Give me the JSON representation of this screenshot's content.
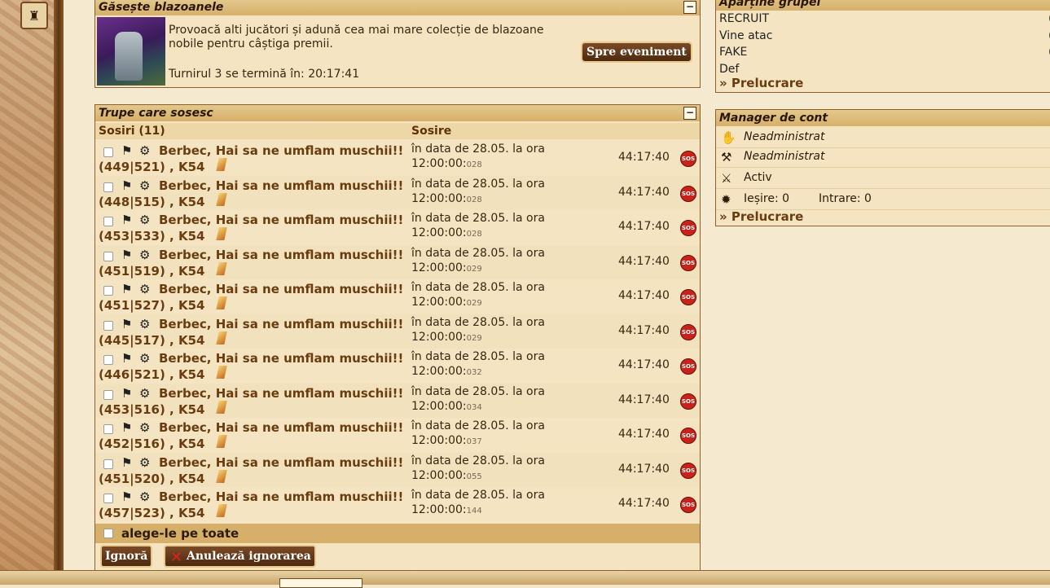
{
  "event_panel": {
    "title": "Găsește blazoanele",
    "description": "Provoacă alti jucători și adună cea mai mare colecție de blazoane nobile pentru câștiga premii.",
    "timer": "Turnirul 3 se termină în: 20:17:41",
    "button": "Spre eveniment"
  },
  "troops_panel": {
    "title": "Trupe care sosesc",
    "col_arrivals": "Sosiri (11)",
    "col_arrival": "Sosire",
    "rows": [
      {
        "name": "Berbec, Hai sa ne umflam muschii!!",
        "coords": "(449|521) , K54",
        "arrival": "în data de 28.05. la ora",
        "time": "12:00:00:",
        "ms": "028",
        "countdown": "44:17:40"
      },
      {
        "name": "Berbec, Hai sa ne umflam muschii!!",
        "coords": "(448|515) , K54",
        "arrival": "în data de 28.05. la ora",
        "time": "12:00:00:",
        "ms": "028",
        "countdown": "44:17:40"
      },
      {
        "name": "Berbec, Hai sa ne umflam muschii!!",
        "coords": "(453|533) , K54",
        "arrival": "în data de 28.05. la ora",
        "time": "12:00:00:",
        "ms": "028",
        "countdown": "44:17:40"
      },
      {
        "name": "Berbec, Hai sa ne umflam muschii!!",
        "coords": "(451|519) , K54",
        "arrival": "în data de 28.05. la ora",
        "time": "12:00:00:",
        "ms": "029",
        "countdown": "44:17:40"
      },
      {
        "name": "Berbec, Hai sa ne umflam muschii!!",
        "coords": "(451|527) , K54",
        "arrival": "în data de 28.05. la ora",
        "time": "12:00:00:",
        "ms": "029",
        "countdown": "44:17:40"
      },
      {
        "name": "Berbec, Hai sa ne umflam muschii!!",
        "coords": "(445|517) , K54",
        "arrival": "în data de 28.05. la ora",
        "time": "12:00:00:",
        "ms": "029",
        "countdown": "44:17:40"
      },
      {
        "name": "Berbec, Hai sa ne umflam muschii!!",
        "coords": "(446|521) , K54",
        "arrival": "în data de 28.05. la ora",
        "time": "12:00:00:",
        "ms": "032",
        "countdown": "44:17:40"
      },
      {
        "name": "Berbec, Hai sa ne umflam muschii!!",
        "coords": "(453|516) , K54",
        "arrival": "în data de 28.05. la ora",
        "time": "12:00:00:",
        "ms": "034",
        "countdown": "44:17:40"
      },
      {
        "name": "Berbec, Hai sa ne umflam muschii!!",
        "coords": "(452|516) , K54",
        "arrival": "în data de 28.05. la ora",
        "time": "12:00:00:",
        "ms": "037",
        "countdown": "44:17:40"
      },
      {
        "name": "Berbec, Hai sa ne umflam muschii!!",
        "coords": "(451|520) , K54",
        "arrival": "în data de 28.05. la ora",
        "time": "12:00:00:",
        "ms": "055",
        "countdown": "44:17:40"
      },
      {
        "name": "Berbec, Hai sa ne umflam muschii!!",
        "coords": "(457|523) , K54",
        "arrival": "în data de 28.05. la ora",
        "time": "12:00:00:",
        "ms": "144",
        "countdown": "44:17:40"
      }
    ],
    "select_all": "alege-le pe toate",
    "ignore_button": "Ignoră",
    "cancel_ignore_button": "Anulează ignorarea",
    "sos_label": "SOS"
  },
  "groups_panel": {
    "title": "Aparține grupei",
    "groups": [
      "RECRUIT",
      "Vine atac",
      "FAKE",
      "Def"
    ],
    "edit_link": "» Prelucrare"
  },
  "account_panel": {
    "title": "Manager de cont",
    "rows": [
      {
        "icon": "hand-icon",
        "text": "Neadministrat"
      },
      {
        "icon": "anvil-icon",
        "text": "Neadministrat"
      },
      {
        "icon": "crossed-swords-icon",
        "text": "Activ"
      },
      {
        "icon": "wheel-icon",
        "text": "Ieșire: 0",
        "text2": "Intrare: 0"
      }
    ],
    "edit_link": "» Prelucrare"
  }
}
